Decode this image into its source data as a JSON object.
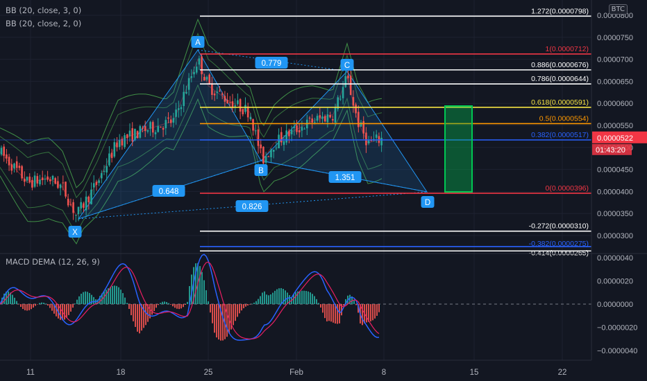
{
  "indicators": [
    {
      "label": "BB (20, close, 3, 0)"
    },
    {
      "label": "BB (20, close, 2, 0)"
    },
    {
      "label": "MACD DEMA (12, 26, 9)"
    }
  ],
  "symbol_badge": "BTC",
  "price_axis": {
    "ticks": [
      "0.0000800",
      "0.0000750",
      "0.0000700",
      "0.0000650",
      "0.0000600",
      "0.0000550",
      "0.0000500",
      "0.0000450",
      "0.0000400",
      "0.0000350",
      "0.0000300"
    ],
    "current_price": "0.0000522",
    "countdown": "01:43:20",
    "current_color": "#f23645"
  },
  "macd_axis": {
    "ticks": [
      "0.0000040",
      "0.0000020",
      "0.0000000",
      "−0.0000020",
      "−0.0000040"
    ]
  },
  "time_axis": {
    "ticks": [
      "11",
      "18",
      "25",
      "Feb",
      "8",
      "15",
      "22"
    ]
  },
  "fib_levels": [
    {
      "label": "1.272(0.0000798)",
      "color": "#ffffff"
    },
    {
      "label": "1(0.0000712)",
      "color": "#f23645"
    },
    {
      "label": "0.886(0.0000676)",
      "color": "#ffffff"
    },
    {
      "label": "0.786(0.0000644)",
      "color": "#ffffff"
    },
    {
      "label": "0.618(0.0000591)",
      "color": "#f5e342"
    },
    {
      "label": "0.5(0.0000554)",
      "color": "#ff9800"
    },
    {
      "label": "0.382(0.0000517)",
      "color": "#2962ff"
    },
    {
      "label": "0(0.0000396)",
      "color": "#f23645"
    },
    {
      "label": "-0.272(0.0000310)",
      "color": "#ffffff"
    },
    {
      "label": "-0.382(0.0000275)",
      "color": "#2962ff"
    },
    {
      "label": "-0.414(0.0000265)",
      "color": "#ffffff"
    }
  ],
  "harmonic": {
    "points": [
      "X",
      "A",
      "B",
      "C",
      "D"
    ],
    "ratios": [
      "0.779",
      "0.648",
      "1.351",
      "0.826"
    ],
    "color": "#2196f3"
  },
  "colors": {
    "background": "#131722",
    "up": "#26a69a",
    "down": "#ef5350",
    "bollinger": "#4caf50",
    "macd_line": "#2962ff",
    "signal_line": "#e91e63",
    "target_box": "#00c853"
  },
  "chart_data": {
    "type": "candlestick",
    "price_range": [
      2.6e-05,
      8.3e-05
    ],
    "macd_range": [
      -4.8e-06,
      4.8e-06
    ],
    "legend": "top-left"
  }
}
